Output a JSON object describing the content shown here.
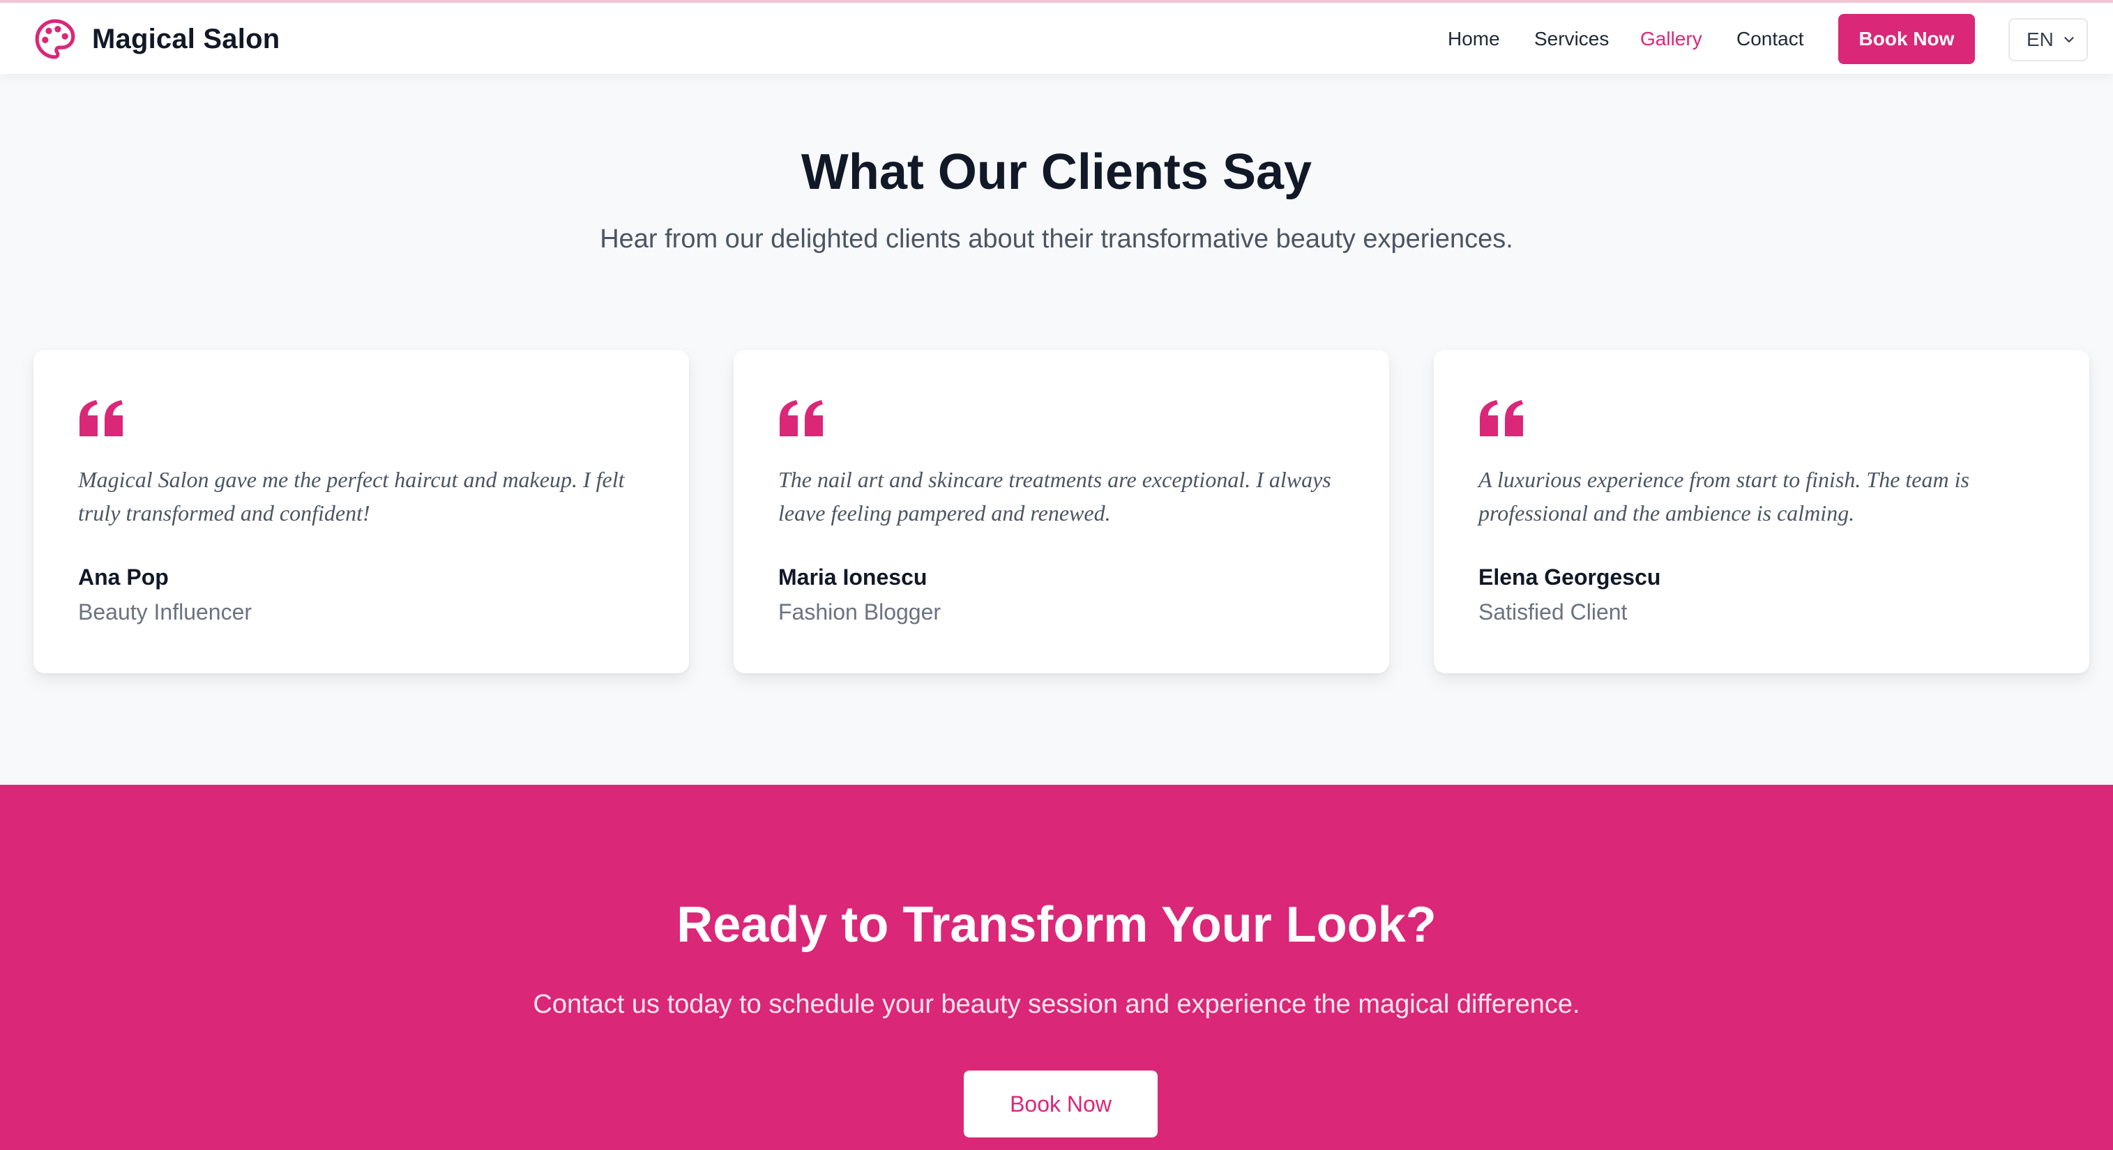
{
  "colors": {
    "accent": "#db2777",
    "background": "#f8f9fb",
    "text_dark": "#111827",
    "text_muted": "#6b7280"
  },
  "header": {
    "brand": "Magical Salon",
    "logo_icon": "palette-icon",
    "nav": [
      {
        "label": "Home",
        "active": false
      },
      {
        "label": "Services",
        "active": false
      },
      {
        "label": "Gallery",
        "active": true
      },
      {
        "label": "Contact",
        "active": false
      }
    ],
    "book_label": "Book Now",
    "language": "EN"
  },
  "testimonials": {
    "title": "What Our Clients Say",
    "subtitle": "Hear from our delighted clients about their transformative beauty experiences.",
    "items": [
      {
        "quote": "Magical Salon gave me the perfect haircut and makeup. I felt truly transformed and confident!",
        "name": "Ana Pop",
        "role": "Beauty Influencer"
      },
      {
        "quote": "The nail art and skincare treatments are exceptional. I always leave feeling pampered and renewed.",
        "name": "Maria Ionescu",
        "role": "Fashion Blogger"
      },
      {
        "quote": "A luxurious experience from start to finish. The team is professional and the ambience is calming.",
        "name": "Elena Georgescu",
        "role": "Satisfied Client"
      }
    ]
  },
  "cta": {
    "title": "Ready to Transform Your Look?",
    "subtitle": "Contact us today to schedule your beauty session and experience the magical difference.",
    "button_label": "Book Now"
  }
}
